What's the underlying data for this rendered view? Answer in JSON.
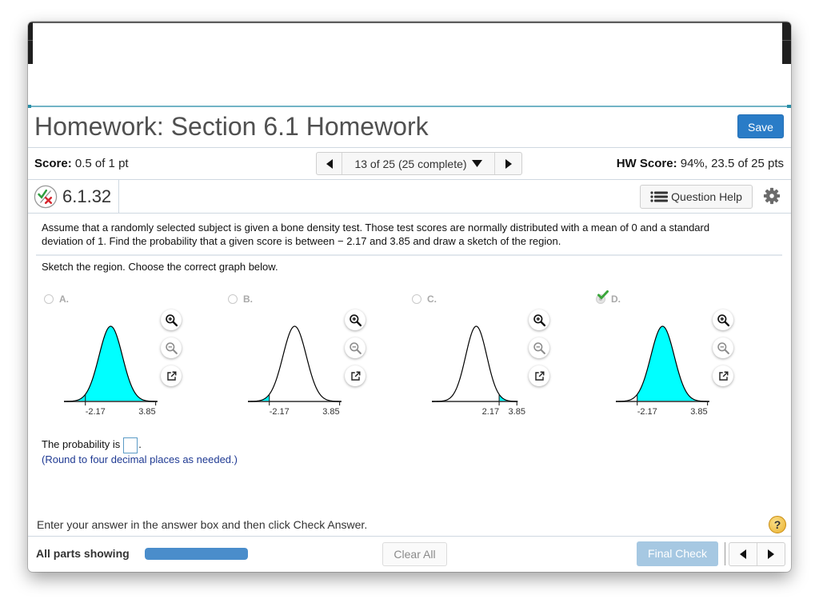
{
  "header": {
    "title": "Homework: Section 6.1 Homework",
    "save_label": "Save"
  },
  "score_bar": {
    "score_label": "Score:",
    "score_value": "0.5 of 1 pt",
    "nav": {
      "position_label": "13 of 25 (25 complete)",
      "prev_icon": "triangle-left-icon",
      "dropdown_icon": "triangle-down-icon",
      "next_icon": "triangle-right-icon"
    },
    "hw_score_label": "HW Score:",
    "hw_score_value": "94%, 23.5 of 25 pts"
  },
  "question_bar": {
    "status_icon": "partially-correct-icon",
    "question_number": "6.1.32",
    "help_button_icon": "list-icon",
    "help_button_label": "Question Help",
    "settings_icon": "gear-icon"
  },
  "question": {
    "prompt": "Assume that a randomly selected subject is given a bone density test. Those test scores are normally distributed with a mean of 0 and a standard deviation of 1. Find the probability that a given score is between  − 2.17 and 3.85 and draw a sketch of the region.",
    "sketch_instruction": "Sketch the region. Choose the correct graph below.",
    "graph_tools": {
      "zoom_in_icon": "zoom-in-icon",
      "zoom_out_icon": "zoom-out-icon",
      "popout_icon": "external-link-icon"
    },
    "options": [
      {
        "letter": "A.",
        "selected": false,
        "marked_correct": false,
        "graph": {
          "type": "normal-curve",
          "mean": 0,
          "sd": 1,
          "x_range": [
            -4,
            4
          ],
          "shaded_interval": [
            -4,
            3.85
          ],
          "ticks": [
            {
              "value": -2.17,
              "label": "-2.17"
            },
            {
              "value": 3.85,
              "label": "3.85"
            }
          ]
        }
      },
      {
        "letter": "B.",
        "selected": false,
        "marked_correct": false,
        "graph": {
          "type": "normal-curve",
          "mean": 0,
          "sd": 1,
          "x_range": [
            -4,
            4
          ],
          "shaded_interval": [
            -4,
            -2.17
          ],
          "ticks": [
            {
              "value": -2.17,
              "label": "-2.17"
            },
            {
              "value": 3.85,
              "label": "3.85"
            }
          ]
        }
      },
      {
        "letter": "C.",
        "selected": false,
        "marked_correct": false,
        "graph": {
          "type": "normal-curve",
          "mean": 0,
          "sd": 1,
          "x_range": [
            -4.2,
            3.93
          ],
          "shaded_interval": [
            2.17,
            3.85
          ],
          "ticks": [
            {
              "value": 2.17,
              "label": "2.17"
            },
            {
              "value": 3.85,
              "label": "3.85"
            }
          ]
        }
      },
      {
        "letter": "D.",
        "selected": true,
        "marked_correct": true,
        "graph": {
          "type": "normal-curve",
          "mean": 0,
          "sd": 1,
          "x_range": [
            -4,
            4
          ],
          "shaded_interval": [
            -2.17,
            3.85
          ],
          "ticks": [
            {
              "value": -2.17,
              "label": "-2.17"
            },
            {
              "value": 3.85,
              "label": "3.85"
            }
          ]
        }
      }
    ],
    "answer": {
      "prefix": "The probability is",
      "value": "",
      "suffix": ".",
      "hint": "(Round to four decimal places as needed.)"
    }
  },
  "footer": {
    "instruction": "Enter your answer in the answer box and then click Check Answer.",
    "help_icon_label": "?",
    "parts_label": "All parts showing",
    "parts_progress": 1.0,
    "clear_all_label": "Clear All",
    "final_check_label": "Final Check",
    "prev_icon": "triangle-left-icon",
    "next_icon": "triangle-right-icon"
  },
  "colors": {
    "accent": "#2a7cc7",
    "shade_fill": "#00ffff",
    "progress": "#4a8dcb",
    "final_check": "#a6c8e2",
    "hint_text": "#1f3a93",
    "correct_check": "#3aa53a",
    "incorrect_x": "#d7262e"
  }
}
